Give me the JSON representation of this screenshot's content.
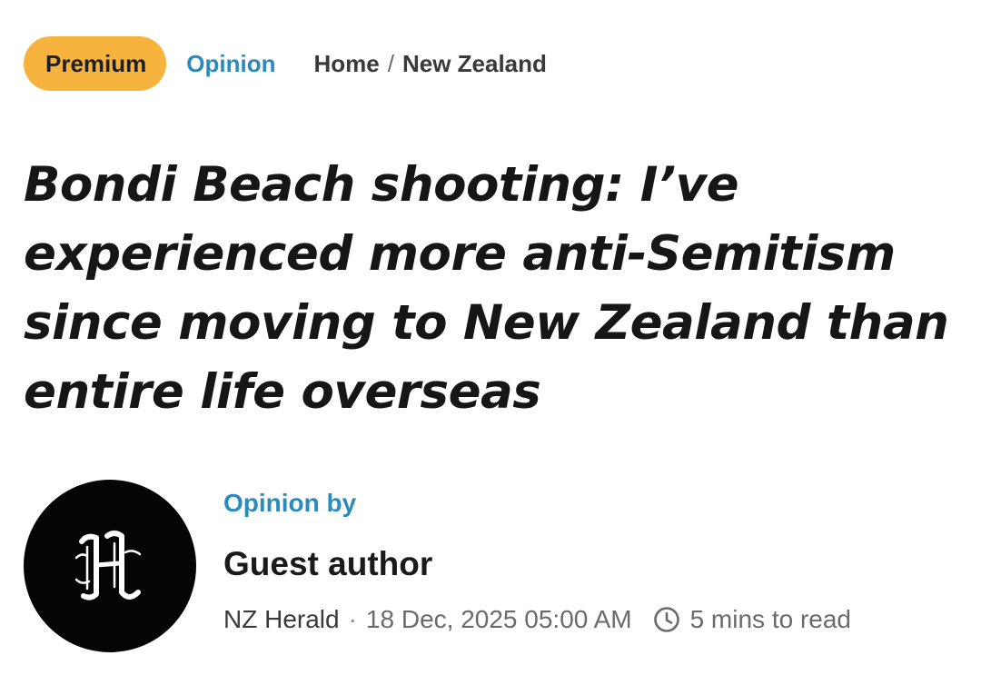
{
  "tags": {
    "premium_label": "Premium",
    "opinion_label": "Opinion"
  },
  "breadcrumb": {
    "items": [
      "Home",
      "New Zealand"
    ],
    "separator": "/"
  },
  "article": {
    "headline": "Bondi Beach shooting: I’ve experienced more anti-Semitism since moving to New Zealand than entire life overseas"
  },
  "byline": {
    "kicker": "Opinion by",
    "author": "Guest author",
    "avatar_icon": "nz-herald-logo-icon",
    "source": "NZ Herald",
    "separator": "·",
    "published": "18 Dec, 2025 05:00 AM",
    "read_icon": "clock-icon",
    "read_time": "5 mins to read"
  },
  "colors": {
    "premium_badge": "#f6b33d",
    "accent_link": "#2a8bbd",
    "avatar_bg": "#050505",
    "headline": "#161616",
    "meta_text": "#6b6b6b"
  }
}
